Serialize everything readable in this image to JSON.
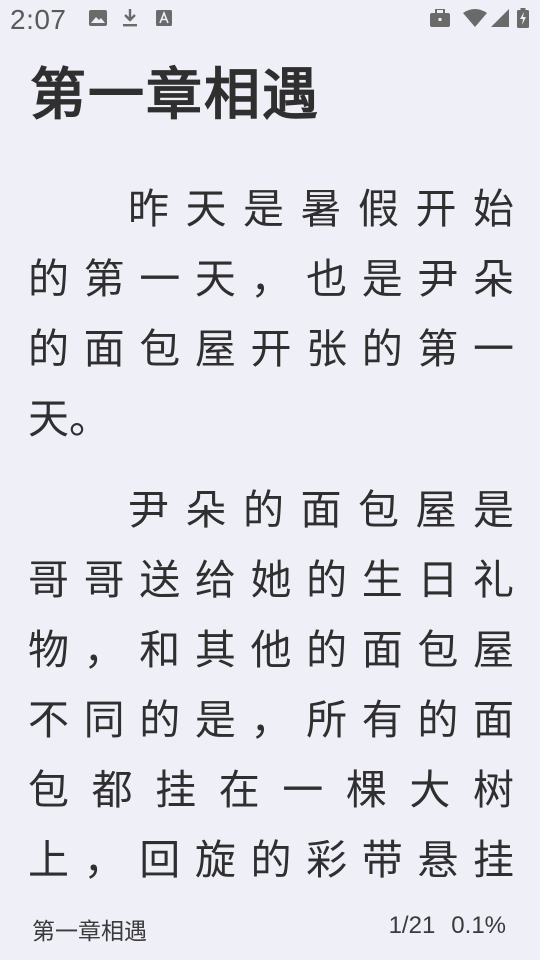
{
  "status_bar": {
    "time": "2:07",
    "left_icons": [
      "image-icon",
      "download-icon",
      "text-a-icon"
    ],
    "right_icons": [
      "briefcase-icon",
      "wifi-icon",
      "signal-icon",
      "battery-charging-icon"
    ]
  },
  "reader": {
    "chapter_title": "第一章相遇",
    "paragraphs": [
      [
        "昨天是暑假开始",
        "的第一天，也是尹朵",
        "的面包屋开张的第一",
        "天。"
      ],
      [
        "尹朵的面包屋是",
        "哥哥送给她的生日礼",
        "物，和其他的面包屋",
        "不同的是，所有的面",
        "包都挂在一棵大树",
        "上，回旋的彩带悬挂"
      ]
    ]
  },
  "footer": {
    "chapter": "第一章相遇",
    "page": "1/21",
    "percent": "0.1%"
  }
}
